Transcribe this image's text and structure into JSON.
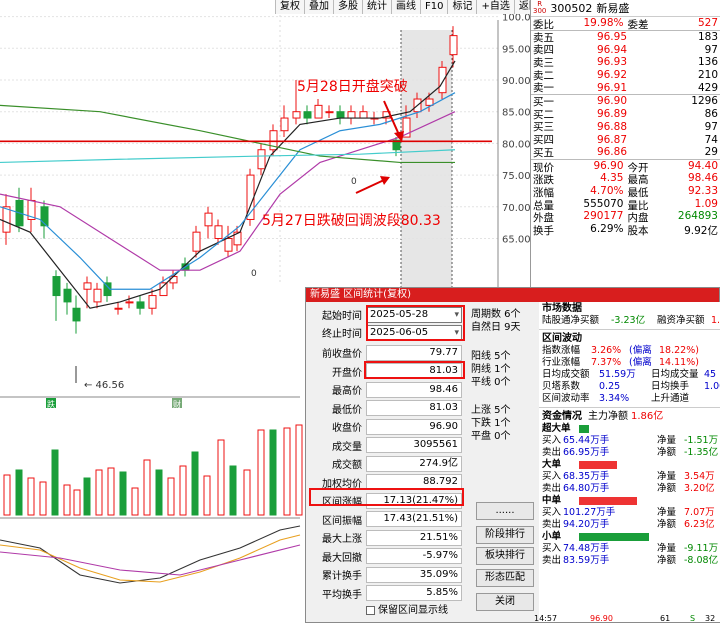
{
  "toolbar": [
    "复权",
    "叠加",
    "多股",
    "统计",
    "画线",
    "F10",
    "标记",
    "+自选",
    "返回"
  ],
  "axis": {
    "ticks": [
      "100.0",
      "95.00",
      "90.00",
      "85.00",
      "80.00",
      "75.00",
      "70.00",
      "65.00"
    ],
    "low_label": "46.56",
    "ma_labels": [
      "0",
      "0"
    ],
    "bottom_labels": [
      "跌",
      "财"
    ]
  },
  "annotations": {
    "breakout": "5月28日开盘突破",
    "breakdown": "5月27日跌破回调波段80.33"
  },
  "quote": {
    "tag_top": "R",
    "tag_bottom": "300",
    "code": "300502",
    "name": "新易盛",
    "wb": {
      "label": "委比",
      "value": "19.98%",
      "label2": "委差",
      "value2": "527"
    },
    "asks": [
      {
        "label": "卖五",
        "price": "96.95",
        "vol": "183"
      },
      {
        "label": "卖四",
        "price": "96.94",
        "vol": "97"
      },
      {
        "label": "卖三",
        "price": "96.93",
        "vol": "136"
      },
      {
        "label": "卖二",
        "price": "96.92",
        "vol": "210"
      },
      {
        "label": "卖一",
        "price": "96.91",
        "vol": "429"
      }
    ],
    "bids": [
      {
        "label": "买一",
        "price": "96.90",
        "vol": "1296"
      },
      {
        "label": "买二",
        "price": "96.89",
        "vol": "86"
      },
      {
        "label": "买三",
        "price": "96.88",
        "vol": "97"
      },
      {
        "label": "买四",
        "price": "96.87",
        "vol": "74"
      },
      {
        "label": "买五",
        "price": "96.86",
        "vol": "29"
      }
    ],
    "stats": [
      [
        "现价",
        "96.90",
        "今开",
        "94.40"
      ],
      [
        "涨跌",
        "4.35",
        "最高",
        "98.46"
      ],
      [
        "涨幅",
        "4.70%",
        "最低",
        "92.33"
      ],
      [
        "总量",
        "555070",
        "量比",
        "1.09"
      ],
      [
        "外盘",
        "290177",
        "内盘",
        "264893"
      ],
      [
        "换手",
        "6.29%",
        "股本",
        "9.92亿"
      ]
    ]
  },
  "dialog": {
    "title": "新易盛 区间统计(复权)",
    "start": {
      "label": "起始时间",
      "value": "2025-05-28"
    },
    "end": {
      "label": "终止时间",
      "value": "2025-06-05"
    },
    "fields": [
      [
        "前收盘价",
        "79.77"
      ],
      [
        "开盘价",
        "81.03"
      ],
      [
        "最高价",
        "98.46"
      ],
      [
        "最低价",
        "81.03"
      ],
      [
        "收盘价",
        "96.90"
      ],
      [
        "成交量",
        "3095561"
      ],
      [
        "成交额",
        "274.9亿"
      ],
      [
        "加权均价",
        "88.792"
      ],
      [
        "区间涨幅",
        "17.13(21.47%)"
      ],
      [
        "区间振幅",
        "17.43(21.51%)"
      ],
      [
        "最大上涨",
        "21.51%"
      ],
      [
        "最大回撤",
        "-5.97%"
      ],
      [
        "累计换手",
        "35.09%"
      ],
      [
        "平均换手",
        "5.85%"
      ]
    ],
    "period": [
      "周期数 6个",
      "自然日 9天"
    ],
    "counts1": [
      "阳线 5个",
      "阴线 1个",
      "平线 0个"
    ],
    "counts2": [
      "上涨 5个",
      "下跌 1个",
      "平盘 0个"
    ],
    "buttons": [
      "......",
      "阶段排行",
      "板块排行",
      "形态匹配",
      "关闭"
    ],
    "checkbox": "保留区间显示线",
    "market": {
      "title": "市场数据",
      "lgt_label": "陆股通净买额",
      "lgt_value": "-3.23亿",
      "rz_label": "融资净买额",
      "rz_value": "1.7"
    },
    "range": {
      "title": "区间波动",
      "rows": [
        [
          "指数涨幅",
          "3.26%",
          "(偏离",
          "18.22%)"
        ],
        [
          "行业涨幅",
          "7.37%",
          "(偏离",
          "14.11%)"
        ]
      ],
      "r3": [
        "日均成交额",
        "51.59万",
        "日均成交量",
        "45"
      ],
      "r4": [
        "贝塔系数",
        "0.25",
        "日均换手",
        "1.00"
      ],
      "r5": [
        "区间波动率",
        "3.34%",
        "上升通道",
        ""
      ]
    },
    "fund": {
      "title": "资金情况",
      "flow_label": "主力净额",
      "flow_value": "1.86亿",
      "groups": [
        {
          "name": "超大单",
          "color": "#1a9e3a",
          "w": 10,
          "buy": "65.44万手",
          "sell": "66.95万手",
          "net1": "-1.51万",
          "net2": "-1.35亿"
        },
        {
          "name": "大单",
          "color": "#e33",
          "w": 38,
          "buy": "68.35万手",
          "sell": "64.80万手",
          "net1": "3.54万",
          "net2": "3.20亿"
        },
        {
          "name": "中单",
          "color": "#e33",
          "w": 58,
          "buy": "101.27万手",
          "sell": "94.20万手",
          "net1": "7.07万",
          "net2": "6.23亿"
        },
        {
          "name": "小单",
          "color": "#1a9e3a",
          "w": 70,
          "buy": "74.48万手",
          "sell": "83.59万手",
          "net1": "-9.11万",
          "net2": "-8.08亿"
        }
      ],
      "buy_label": "买入",
      "sell_label": "卖出",
      "net_label": "净量",
      "net2_label": "净额"
    }
  },
  "colors": {
    "up": "#e11",
    "down": "#1a9e3a",
    "ma5": "#222",
    "ma10": "#2a8fd6",
    "ma20": "#b03aa8",
    "ma60": "#3a8f2a",
    "hline": "#d00"
  },
  "bottom": [
    "14:57",
    "96.90",
    "61",
    "S",
    "32"
  ]
}
